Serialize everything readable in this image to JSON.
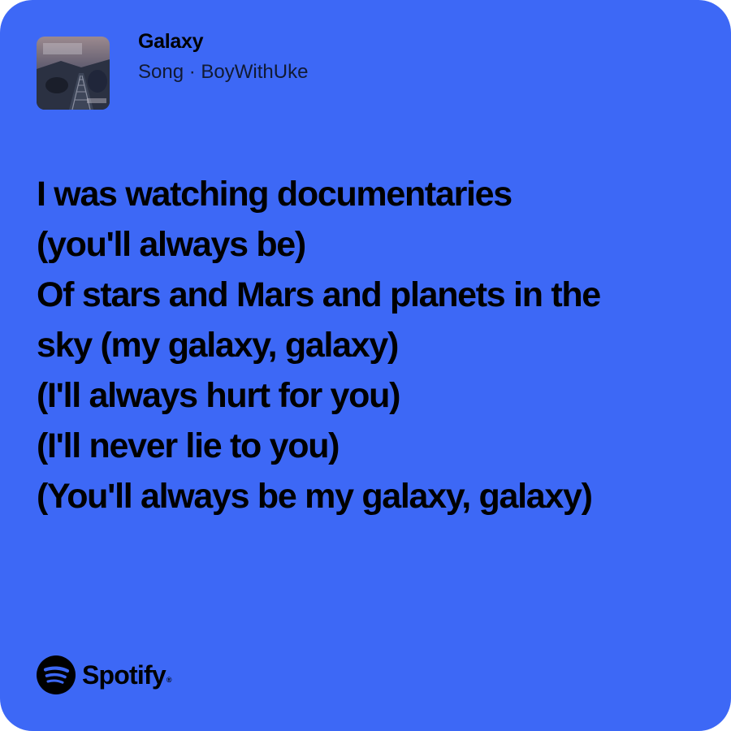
{
  "colors": {
    "background": "#3d68f6",
    "text": "#000000"
  },
  "track": {
    "title": "Galaxy",
    "subtitle": "Song · BoyWithUke",
    "cover_icon": "album-cover-image"
  },
  "lyrics": [
    "I was watching documentaries",
    "(you'll always be)",
    "Of stars and Mars and planets in the",
    "sky (my galaxy, galaxy)",
    "(I'll always hurt for you)",
    "(I'll never lie to you)",
    "(You'll always be my galaxy, galaxy)"
  ],
  "brand": {
    "name": "Spotify",
    "trademark": "®",
    "icon": "spotify-logo-icon"
  }
}
